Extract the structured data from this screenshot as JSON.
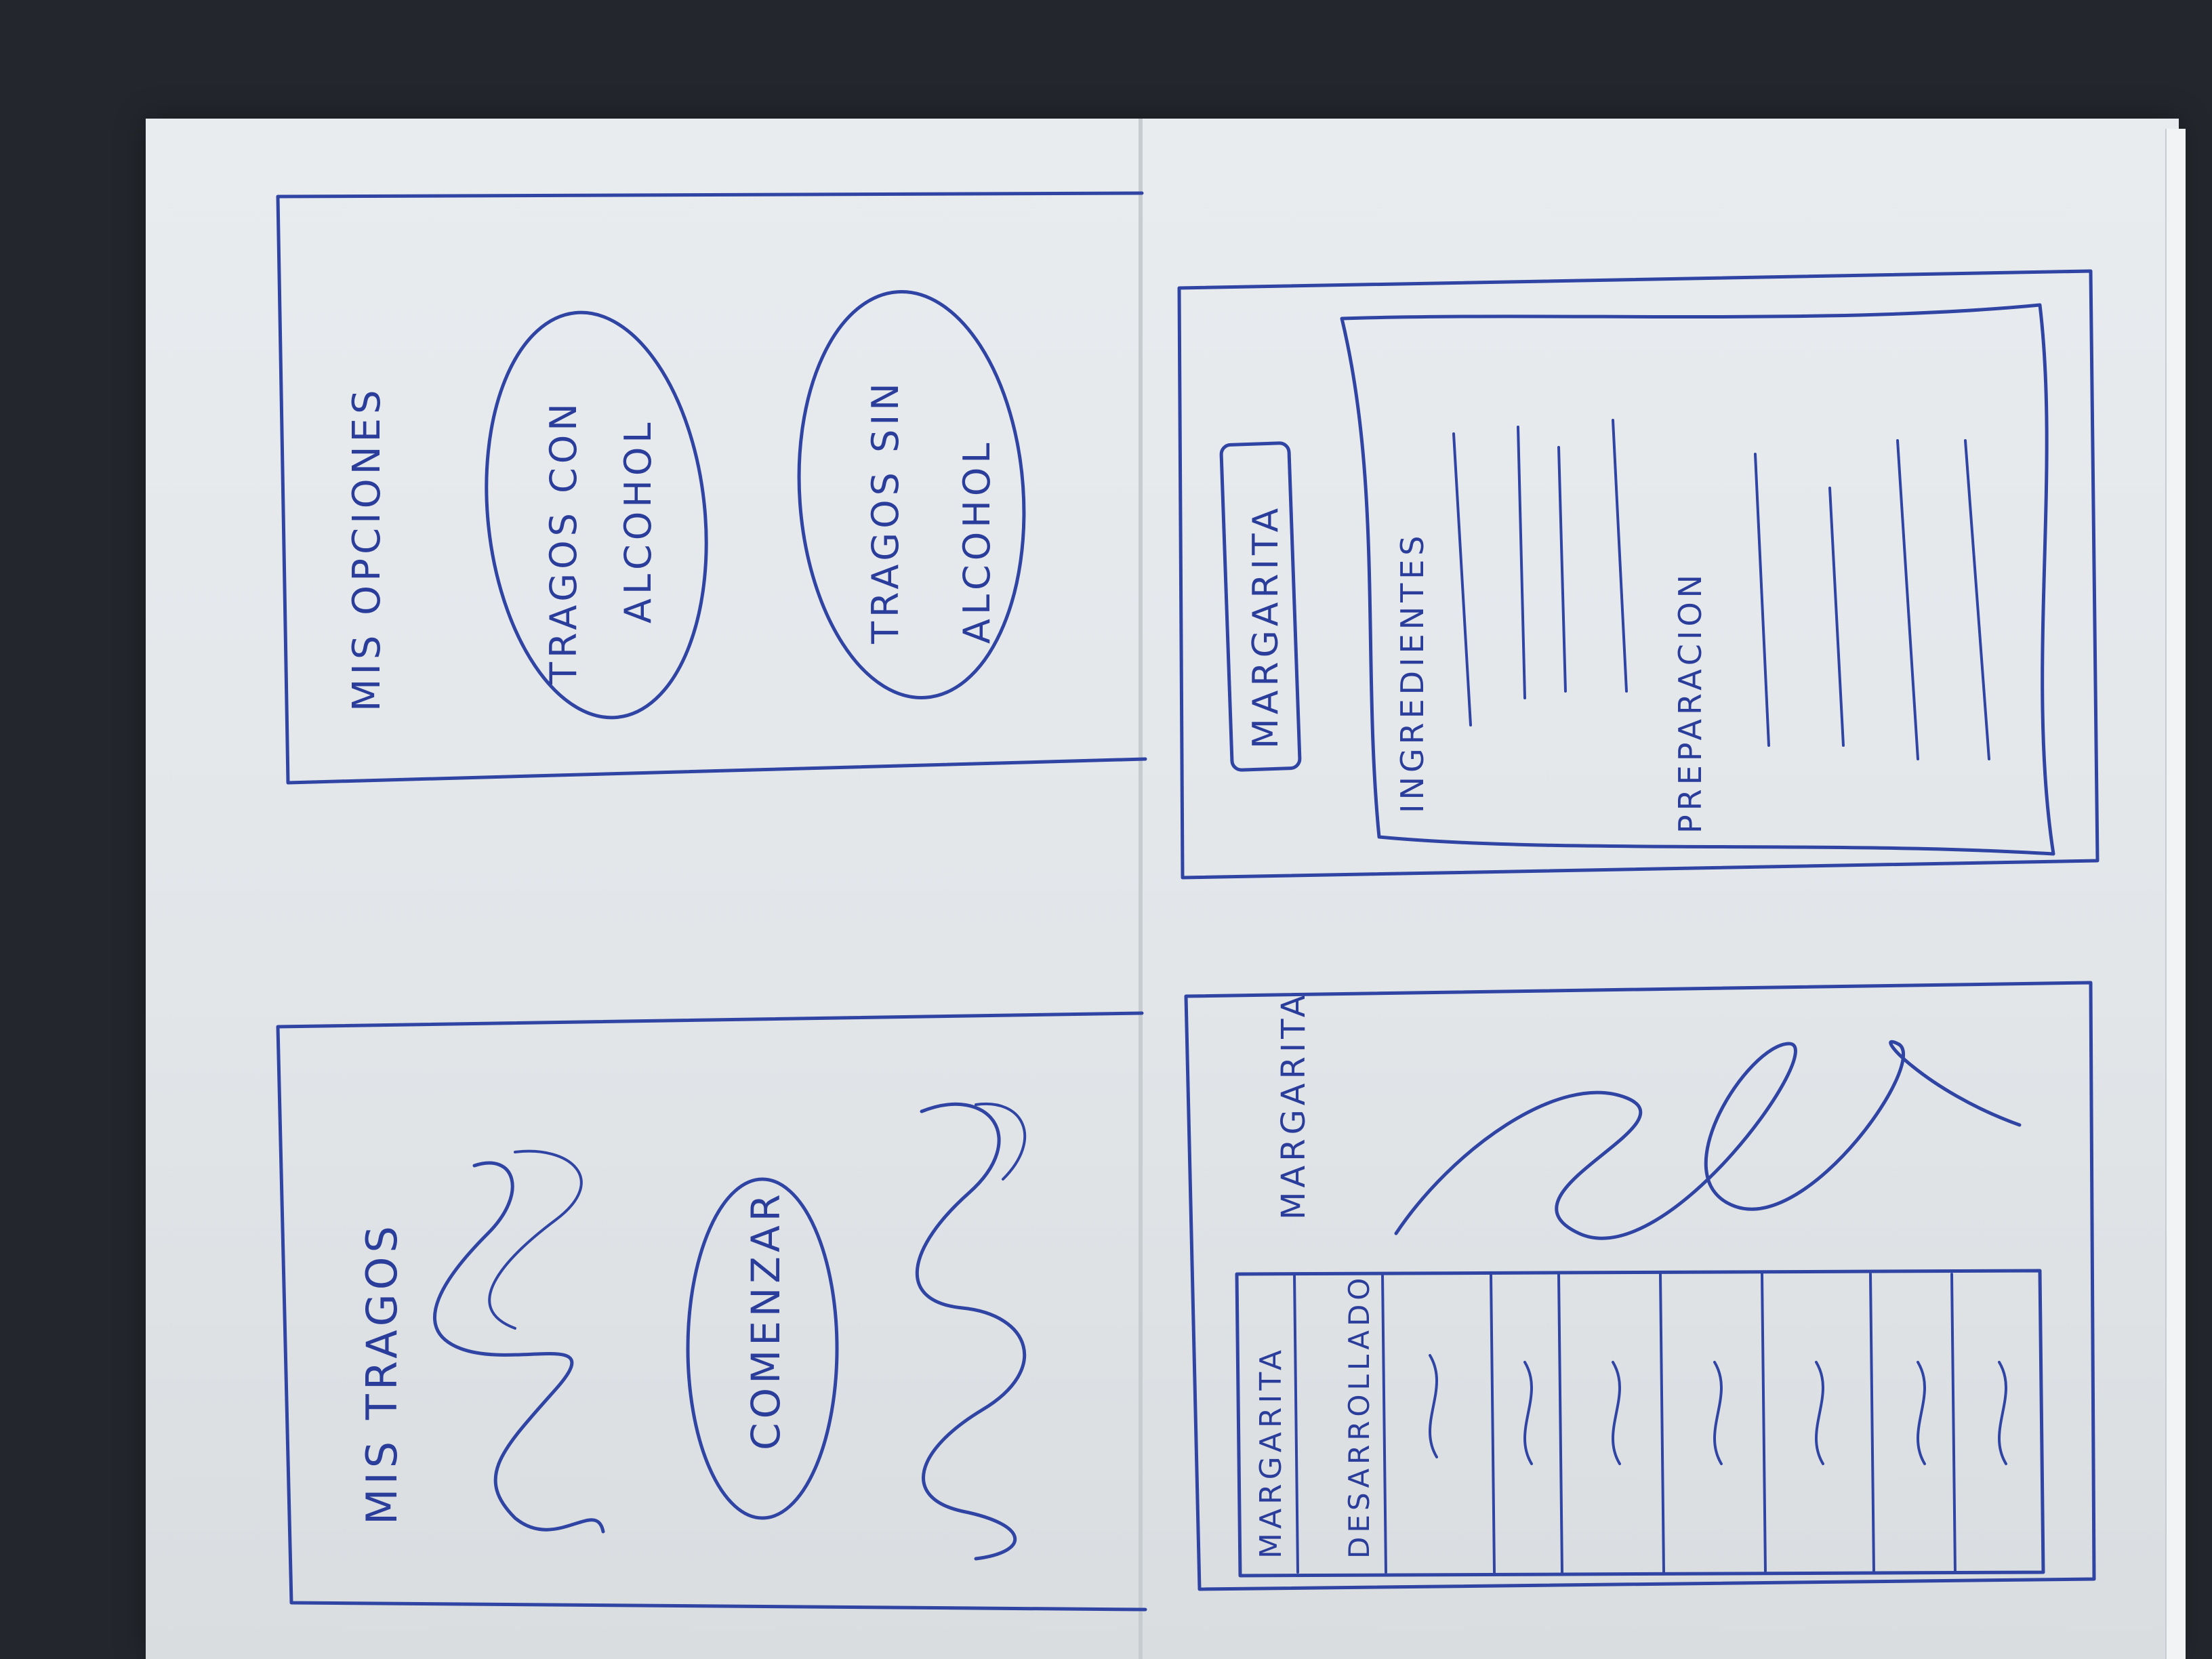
{
  "sketches": {
    "opciones": {
      "title": "MIS OPCIONES",
      "button_alcohol_line1": "TRAGOS CON",
      "button_alcohol_line2": "ALCOHOL",
      "button_sin_alcohol_line1": "TRAGOS SIN",
      "button_sin_alcohol_line2": "ALCOHOL"
    },
    "inicio": {
      "title": "MIS TRAGOS",
      "start_button": "COMENZAR"
    },
    "detalle": {
      "drink_name": "MARGARITA",
      "ingredients_label": "INGREDIENTES",
      "preparation_label": "PREPARACION"
    },
    "lista": {
      "drink_name": "MARGARITA",
      "table_header_col1": "MARGARITA",
      "table_header_col2": "DESARROLLADO"
    }
  },
  "colors": {
    "ink": "#2f44a3",
    "paper": "#e6e9ec",
    "background": "#23272d"
  }
}
